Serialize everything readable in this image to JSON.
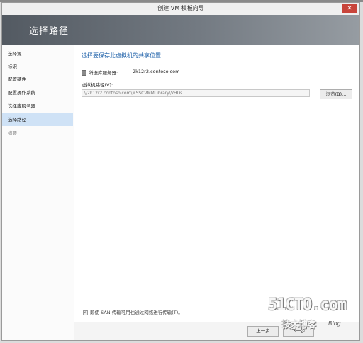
{
  "window": {
    "title": "创建 VM 模板向导",
    "close_glyph": "✕"
  },
  "banner": {
    "title": "选择路径"
  },
  "nav": {
    "items": [
      {
        "label": "选择源"
      },
      {
        "label": "标识"
      },
      {
        "label": "配置硬件"
      },
      {
        "label": "配置操作系统"
      },
      {
        "label": "选择库服务器"
      },
      {
        "label": "选择路径"
      },
      {
        "label": "摘要"
      }
    ],
    "selected_index": 5
  },
  "content": {
    "heading": "选择要保存此虚拟机的共享位置",
    "library_server_label": "所选库服务器:",
    "library_server_value": "2k12r2.contoso.com",
    "vm_path_label": "虚拟机路径(V):",
    "vm_path_value": "\\\\2k12r2.contoso.com\\MSSCVMMLibrary\\VHDs",
    "browse_label": "浏览(B)...",
    "san_option_label": "即使 SAN 传输可用也通过网络进行传输(T)。",
    "san_option_checked": true
  },
  "footer": {
    "prev_label": "上一步",
    "next_label": "下一步"
  },
  "watermark": {
    "logo": "51CTO.com",
    "subtitle": "技术博客",
    "blog": "Blog"
  },
  "colors": {
    "banner": "#5f666e",
    "selected_nav": "#cfe2f6",
    "heading": "#1b5fa8",
    "close": "#c8453b"
  }
}
